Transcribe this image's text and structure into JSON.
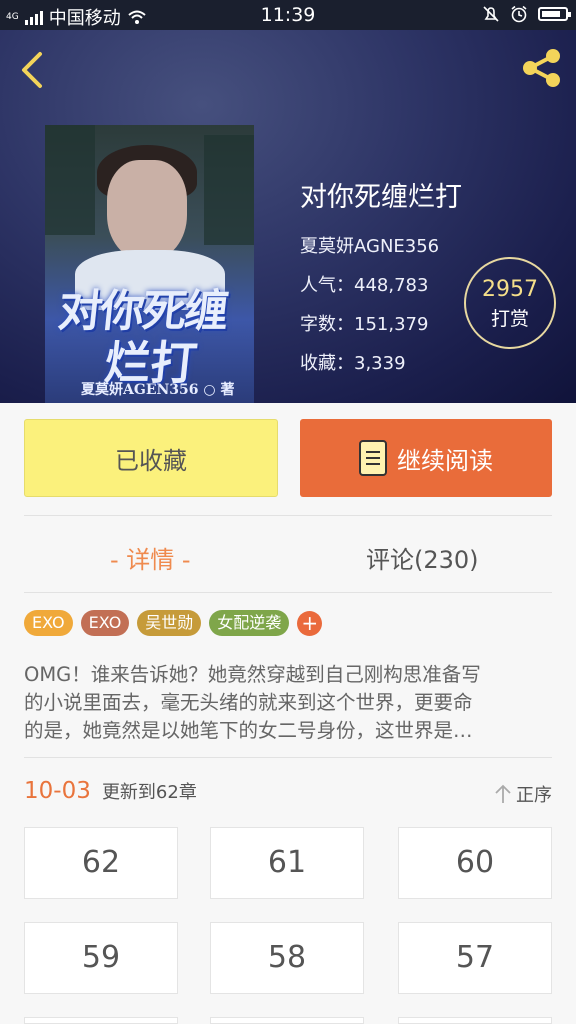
{
  "status_bar": {
    "carrier": "中国移动",
    "network": "4G",
    "time": "11:39",
    "battery_percent": 80
  },
  "book": {
    "title": "对你死缠烂打",
    "author": "夏莫妍AGNE356",
    "popularity": "人气：448,783",
    "word_count": "字数：151,379",
    "favorites": "收藏：3,339",
    "cover_title_line1": "对你死缠",
    "cover_title_line2": "烂打",
    "cover_author": "夏莫妍AGEN356 ○ 著"
  },
  "reward": {
    "count": "2957",
    "label": "打赏"
  },
  "actions": {
    "favorited_label": "已收藏",
    "continue_label": "继续阅读"
  },
  "tabs": [
    {
      "label": "- 详情 -",
      "active": true
    },
    {
      "label": "评论(230)",
      "active": false
    }
  ],
  "tags": [
    {
      "label": "EXO",
      "color": "#f0a93a"
    },
    {
      "label": "EXO",
      "color": "#c26f55"
    },
    {
      "label": "吴世勋",
      "color": "#c69b3a"
    },
    {
      "label": "女配逆袭",
      "color": "#7fa64a"
    }
  ],
  "tag_add": "+",
  "description": {
    "line1": "OMG！谁来告诉她？她竟然穿越到自己刚构思准备写",
    "line2": "的小说里面去，毫无头绪的就来到这个世界，更要命",
    "line3": "的是，她竟然是以她笔下的女二号身份，这世界是…"
  },
  "update": {
    "date": "10-03",
    "text": "更新到62章",
    "sort_label": "正序"
  },
  "chapters": [
    "62",
    "61",
    "60",
    "59",
    "58",
    "57"
  ],
  "colors": {
    "accent": "#e96c3a",
    "favorite_bg": "#fbf17c",
    "reward_text": "#f5df8a"
  },
  "icons": {
    "back": "back-arrow-icon",
    "share": "share-icon",
    "book": "book-icon",
    "sort": "arrow-up-icon"
  }
}
